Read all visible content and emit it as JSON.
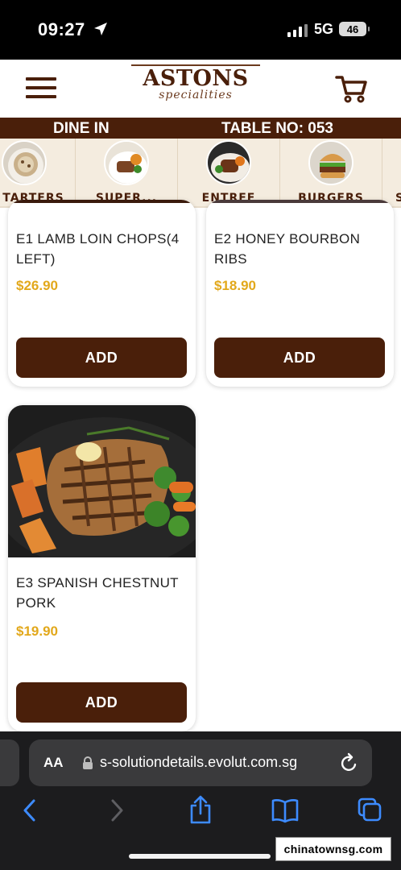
{
  "status_bar": {
    "time": "09:27",
    "network": "5G",
    "battery": "46"
  },
  "header": {
    "brand": {
      "name": "ASTONS",
      "tagline": "specialities"
    },
    "menu_icon": "hamburger-menu-icon",
    "cart_icon": "shopping-cart-icon"
  },
  "order_bar": {
    "mode": "DINE IN",
    "table": "TABLE NO: 053"
  },
  "categories": [
    {
      "label": "TARTERS"
    },
    {
      "label": "SUPER..."
    },
    {
      "label": "ENTREE"
    },
    {
      "label": "BURGERS"
    },
    {
      "label": "S"
    }
  ],
  "products": [
    {
      "name": "E1 LAMB LOIN CHOPS(4 LEFT)",
      "price": "$26.90",
      "button": "ADD"
    },
    {
      "name": "E2 HONEY BOURBON RIBS",
      "price": "$18.90",
      "button": "ADD"
    },
    {
      "name": "E3 SPANISH CHESTNUT PORK",
      "price": "$19.90",
      "button": "ADD"
    }
  ],
  "browser": {
    "aa_label": "AA",
    "url": "s-solutiondetails.evolut.com.sg",
    "icons": [
      "back-icon",
      "forward-icon",
      "share-icon",
      "bookmarks-icon",
      "tabs-icon"
    ]
  },
  "watermark": "chinatownsg.com",
  "colors": {
    "brand_brown": "#4a1f0a",
    "price_gold": "#e2a81b",
    "category_bg": "#f4ecdf"
  }
}
